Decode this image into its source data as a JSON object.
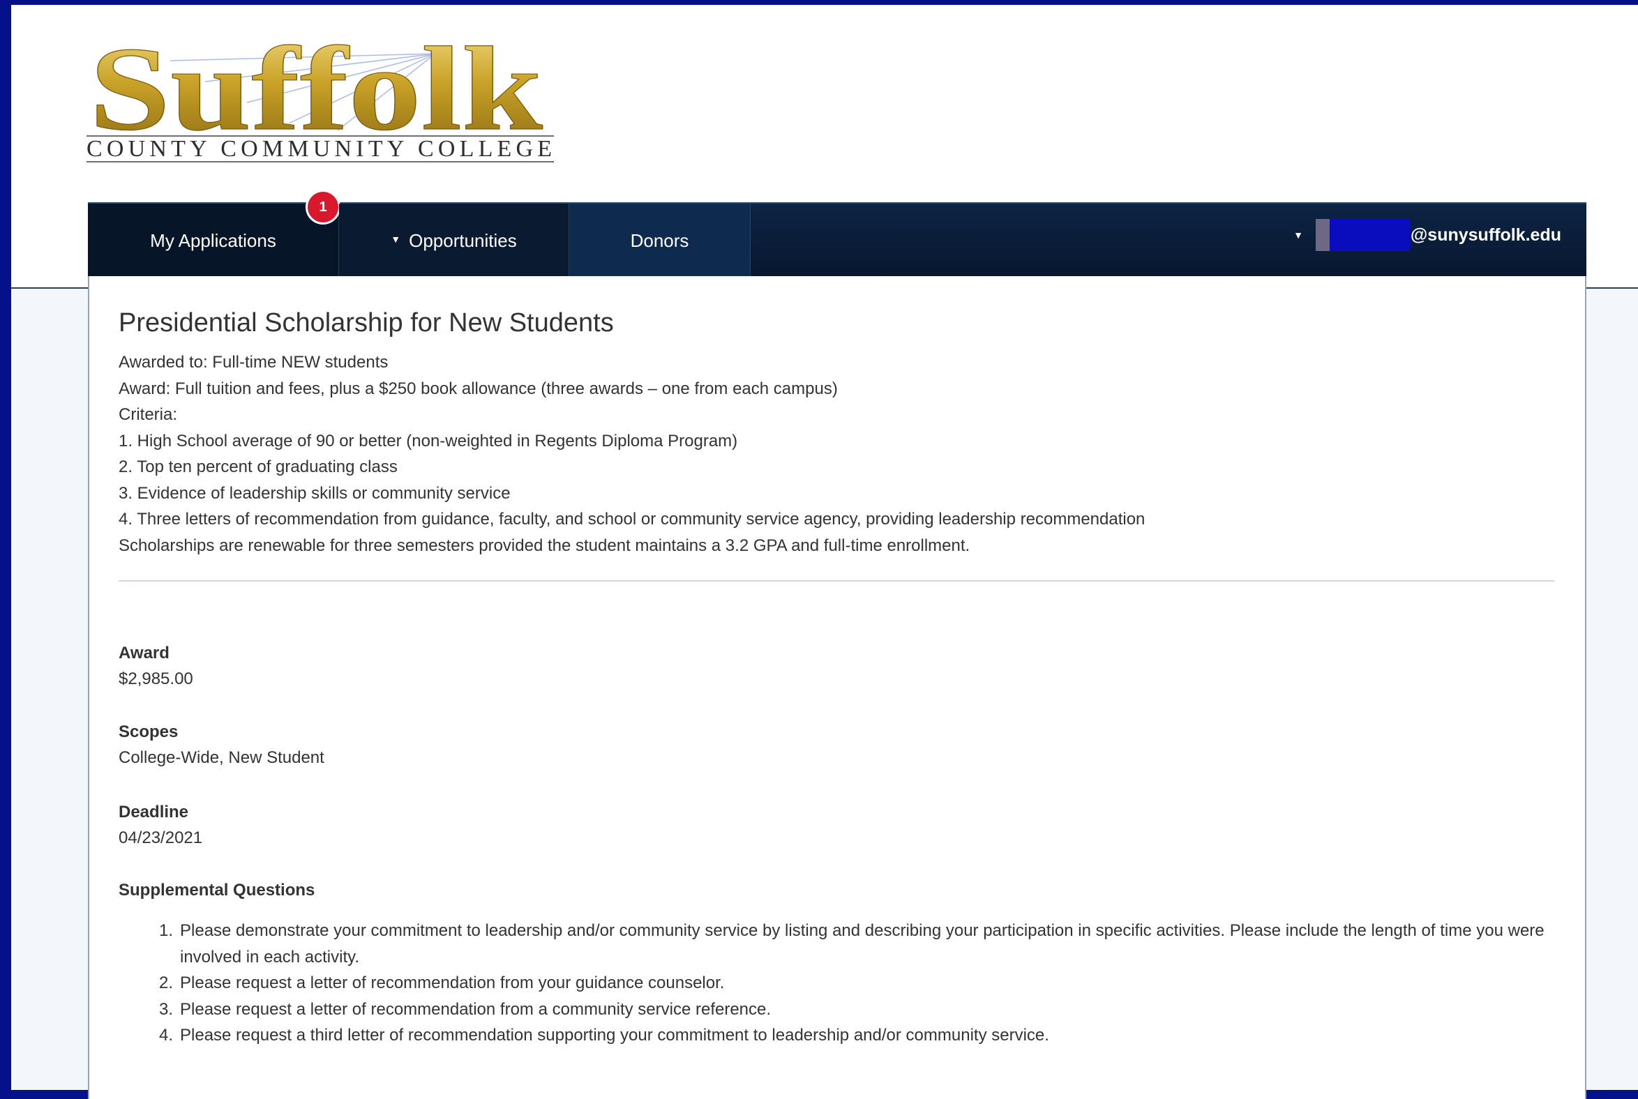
{
  "logo": {
    "wordmark": "Suffolk",
    "tagline": "COUNTY COMMUNITY COLLEGE"
  },
  "nav": {
    "my_applications": "My Applications",
    "notification_count": "1",
    "opportunities": "Opportunities",
    "donors": "Donors",
    "user_email": "@sunysuffolk.edu"
  },
  "scholarship": {
    "title": "Presidential Scholarship for New Students",
    "description_lines": [
      "Awarded to: Full-time NEW students",
      "Award: Full tuition and fees, plus a $250 book allowance (three awards – one from each campus)",
      "Criteria:",
      "1. High School average of 90 or better (non-weighted in Regents Diploma Program)",
      "2. Top ten percent of graduating class",
      "3. Evidence of leadership skills or community service",
      "4. Three letters of recommendation from guidance, faculty, and school or community service agency, providing leadership recommendation",
      "Scholarships are renewable for three semesters provided the student maintains a 3.2 GPA and full-time enrollment."
    ],
    "award_label": "Award",
    "award_value": "$2,985.00",
    "scopes_label": "Scopes",
    "scopes_value": "College-Wide, New Student",
    "deadline_label": "Deadline",
    "deadline_value": "04/23/2021",
    "supplemental_label": "Supplemental Questions",
    "supplemental_questions": [
      {
        "num": "1.",
        "text": "Please demonstrate your commitment to leadership and/or community service by listing and describing your participation in specific activities. Please include the length of time you were involved in each activity."
      },
      {
        "num": "2.",
        "text": "Please request a letter of recommendation from your guidance counselor."
      },
      {
        "num": "3.",
        "text": "Please request a letter of recommendation from a community service reference."
      },
      {
        "num": "4.",
        "text": "Please request a third letter of recommendation supporting your commitment to leadership and/or community service."
      }
    ]
  },
  "colors": {
    "frame": "#04118a",
    "navbar": "#0d2444",
    "badge": "#d9182c",
    "logo_gold": "#c9a227"
  }
}
